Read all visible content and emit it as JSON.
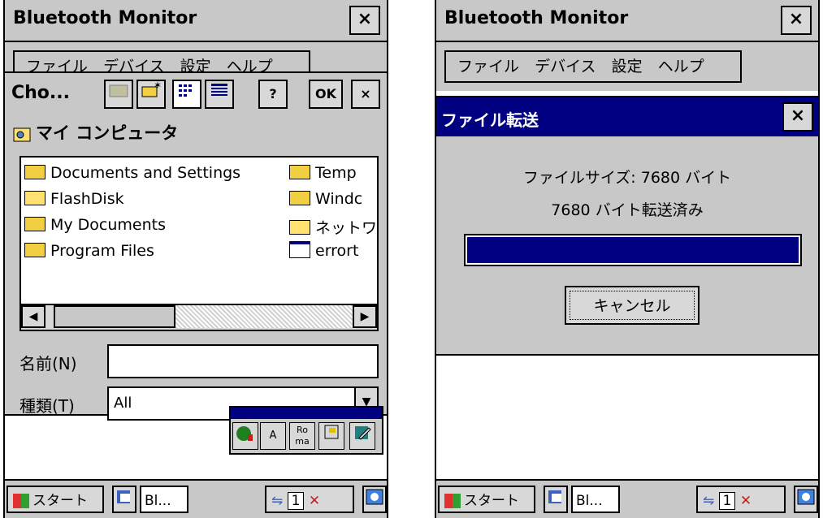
{
  "app": {
    "title": "Bluetooth Monitor"
  },
  "menu": [
    "ファイル",
    "デバイス",
    "設定",
    "ヘルプ"
  ],
  "file_dialog": {
    "title": "Cho...",
    "toolbar": {
      "help": "?",
      "ok": "OK",
      "close": "×"
    },
    "location": "マイ コンピュータ",
    "files": [
      {
        "name": "Documents and Settings",
        "icon": "folder-icon"
      },
      {
        "name": "FlashDisk",
        "icon": "drive-icon"
      },
      {
        "name": "My Documents",
        "icon": "folder-icon"
      },
      {
        "name": "Program Files",
        "icon": "folder-icon"
      },
      {
        "name": "Temp",
        "icon": "folder-icon"
      },
      {
        "name": "Windc",
        "icon": "folder-icon"
      },
      {
        "name": "ネットワ",
        "icon": "network-folder-icon"
      },
      {
        "name": "errort",
        "icon": "window-file-icon"
      }
    ],
    "name_label": "名前(N)",
    "name_value": "",
    "type_label": "種類(T)",
    "type_value": "All"
  },
  "ime": {
    "roma": "Ro ma",
    "a_label": "A"
  },
  "transfer_dialog": {
    "title": "ファイル転送",
    "close": "×",
    "size_text": "ファイルサイズ: 7680 バイト",
    "progress_text": "7680 バイト転送済み",
    "progress": 1.0,
    "cancel_label": "キャンセル"
  },
  "taskbar": {
    "start_label": "スタート",
    "window_label": "Bl...",
    "tray_count": "1"
  },
  "colors": {
    "titlebar_active": "#000080",
    "face": "#c8c8c8",
    "progress": "#000080"
  }
}
